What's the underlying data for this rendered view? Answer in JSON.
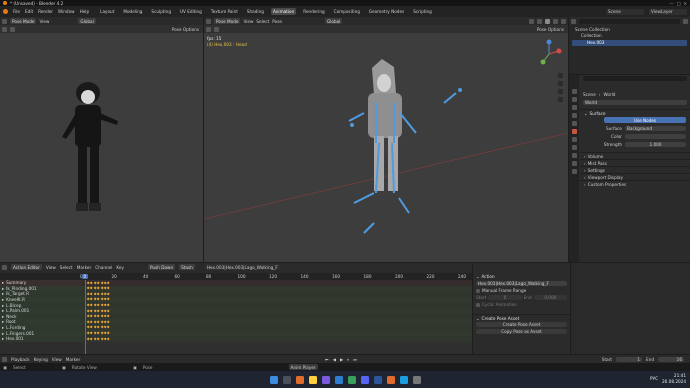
{
  "title": "* (Unsaved) - Blender 4.2",
  "menus": [
    "File",
    "Edit",
    "Render",
    "Window",
    "Help"
  ],
  "workspaces": [
    "Layout",
    "Modeling",
    "Sculpting",
    "UV Editing",
    "Texture Paint",
    "Shading",
    "Animation",
    "Rendering",
    "Compositing",
    "Geometry Nodes",
    "Scripting"
  ],
  "active_workspace": "Animation",
  "scene": {
    "label": "Scene",
    "view_layer": "ViewLayer"
  },
  "left_view": {
    "mode": "Pose Mode",
    "menus": [
      "View"
    ],
    "orientation": "Global",
    "pose_options": "Pose Options"
  },
  "main_view": {
    "mode": "Pose Mode",
    "menus": [
      "View",
      "Select",
      "Pose"
    ],
    "orientation": "Global",
    "pose_options": "Pose Options",
    "info_line1": "fps: 15",
    "info_line2": "(4) Hex.003 : Head"
  },
  "outliner": {
    "items": [
      "Scene Collection",
      "Collection",
      "Hex.003"
    ]
  },
  "properties": {
    "search_placeholder": "",
    "scene_label": "Scene",
    "world_label": "World",
    "world_name": "World",
    "surface_panel": "Surface",
    "use_nodes": "Use Nodes",
    "surface_label": "Surface",
    "surface_value": "Background",
    "color_label": "Color",
    "strength_label": "Strength",
    "strength_value": "1.000",
    "sections": [
      "Volume",
      "Mist Pass",
      "Settings",
      "Viewport Display",
      "Custom Properties"
    ]
  },
  "action_editor": {
    "mode": "Action Editor",
    "menus": [
      "View",
      "Select",
      "Marker",
      "Channel",
      "Key"
    ],
    "push_down": "Push Down",
    "stash": "Stash",
    "action_name": "Hex.003|Hex.003|Lago_Walking_F",
    "ticks": [
      "0",
      "20",
      "40",
      "60",
      "80",
      "100",
      "120",
      "140",
      "160",
      "180",
      "200",
      "220",
      "240"
    ],
    "current_frame": "0",
    "channels": [
      "Summary",
      "Ik_Pinding.001",
      "Ik_Target.R",
      "KneeIK.R",
      "L.Bicep",
      "L.Palm.001",
      "Neck",
      "Root",
      "L.Fording",
      "L.Fingers.001",
      "Hex.001"
    ]
  },
  "action_side": {
    "action_header": "Action",
    "action_value": "Hex.003|Hex.003|Lago_Walking_F",
    "manual_frame_range": "Manual Frame Range",
    "start_label": "Start",
    "end_label": "End",
    "start_value": "0",
    "end_value": "0.000",
    "cyclic": "Cyclic Animation",
    "create_pose_header": "Create Pose Asset",
    "create_pose_button": "Create Pose Asset",
    "copy_pose_button": "Copy Pose as Asset"
  },
  "playback": {
    "menus": [
      "Playback",
      "Keying",
      "View",
      "Marker"
    ],
    "start_label": "Start",
    "start_value": "1",
    "end_label": "End",
    "end_value": "16"
  },
  "statusbar": {
    "left": "Select",
    "mid": "Rotate View",
    "right": "Pose",
    "hint": "Anim Player"
  },
  "taskbar": {
    "lang": "РУС",
    "time": "21:41",
    "date": "26.08.2024"
  },
  "colors": {
    "accent": "#4772b3",
    "keyframe": "#e8a735",
    "active_tab": "#4a4a4a"
  }
}
